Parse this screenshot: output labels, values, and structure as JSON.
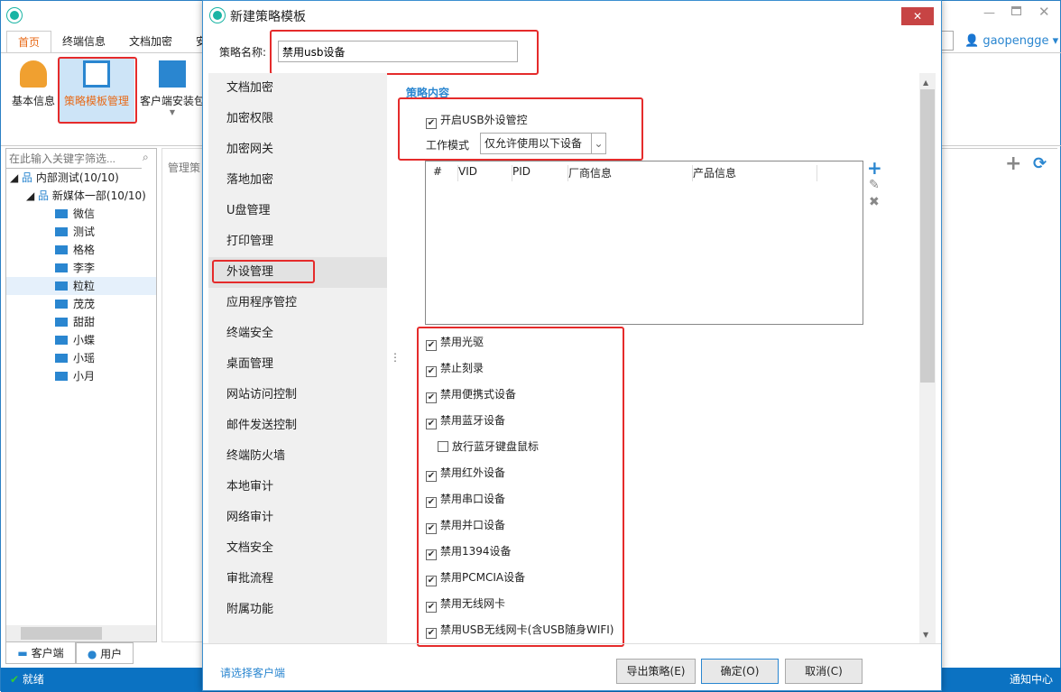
{
  "app": {
    "tabs": [
      "首页",
      "终端信息",
      "文档加密",
      "安"
    ],
    "ribbon": [
      "基本信息",
      "策略模板管理",
      "客户端安装包"
    ],
    "user": "gaopengge",
    "search_placeholder": "在此输入关键字筛选...",
    "tree": {
      "root": "内部测试(10/10)",
      "group": "新媒体一部(10/10)",
      "items": [
        "微信",
        "测试",
        "格格",
        "李李",
        "粒粒",
        "茂茂",
        "甜甜",
        "小蝶",
        "小瑶",
        "小月"
      ],
      "selected": "粒粒"
    },
    "panel_tabs": [
      "客户端",
      "用户"
    ],
    "mgmt_label": "管理策",
    "status": "就绪",
    "notify": "通知中心"
  },
  "dialog": {
    "title": "新建策略模板",
    "name_label": "策略名称:",
    "name_value": "禁用usb设备",
    "nav": [
      "文档加密",
      "加密权限",
      "加密网关",
      "落地加密",
      "U盘管理",
      "打印管理",
      "外设管理",
      "应用程序管控",
      "终端安全",
      "桌面管理",
      "网站访问控制",
      "邮件发送控制",
      "终端防火墙",
      "本地审计",
      "网络审计",
      "文档安全",
      "审批流程",
      "附属功能"
    ],
    "nav_selected": "外设管理",
    "section": "策略内容",
    "usb_enable": {
      "label": "开启USB外设管控",
      "checked": true
    },
    "mode_label": "工作模式",
    "mode_value": "仅允许使用以下设备",
    "table_headers": [
      "#",
      "VID",
      "PID",
      "厂商信息",
      "产品信息"
    ],
    "options": [
      {
        "label": "禁用光驱",
        "checked": true
      },
      {
        "label": "禁止刻录",
        "checked": true
      },
      {
        "label": "禁用便携式设备",
        "checked": true
      },
      {
        "label": "禁用蓝牙设备",
        "checked": true
      },
      {
        "label": "放行蓝牙键盘鼠标",
        "checked": false,
        "indent": true
      },
      {
        "label": "禁用红外设备",
        "checked": true
      },
      {
        "label": "禁用串口设备",
        "checked": true
      },
      {
        "label": "禁用并口设备",
        "checked": true
      },
      {
        "label": "禁用1394设备",
        "checked": true
      },
      {
        "label": "禁用PCMCIA设备",
        "checked": true
      },
      {
        "label": "禁用无线网卡",
        "checked": true
      },
      {
        "label": "禁用USB无线网卡(含USB随身WIFI)",
        "checked": true
      }
    ],
    "footer_link": "请选择客户端",
    "export": "导出策略(E)",
    "ok": "确定(O)",
    "cancel": "取消(C)"
  }
}
